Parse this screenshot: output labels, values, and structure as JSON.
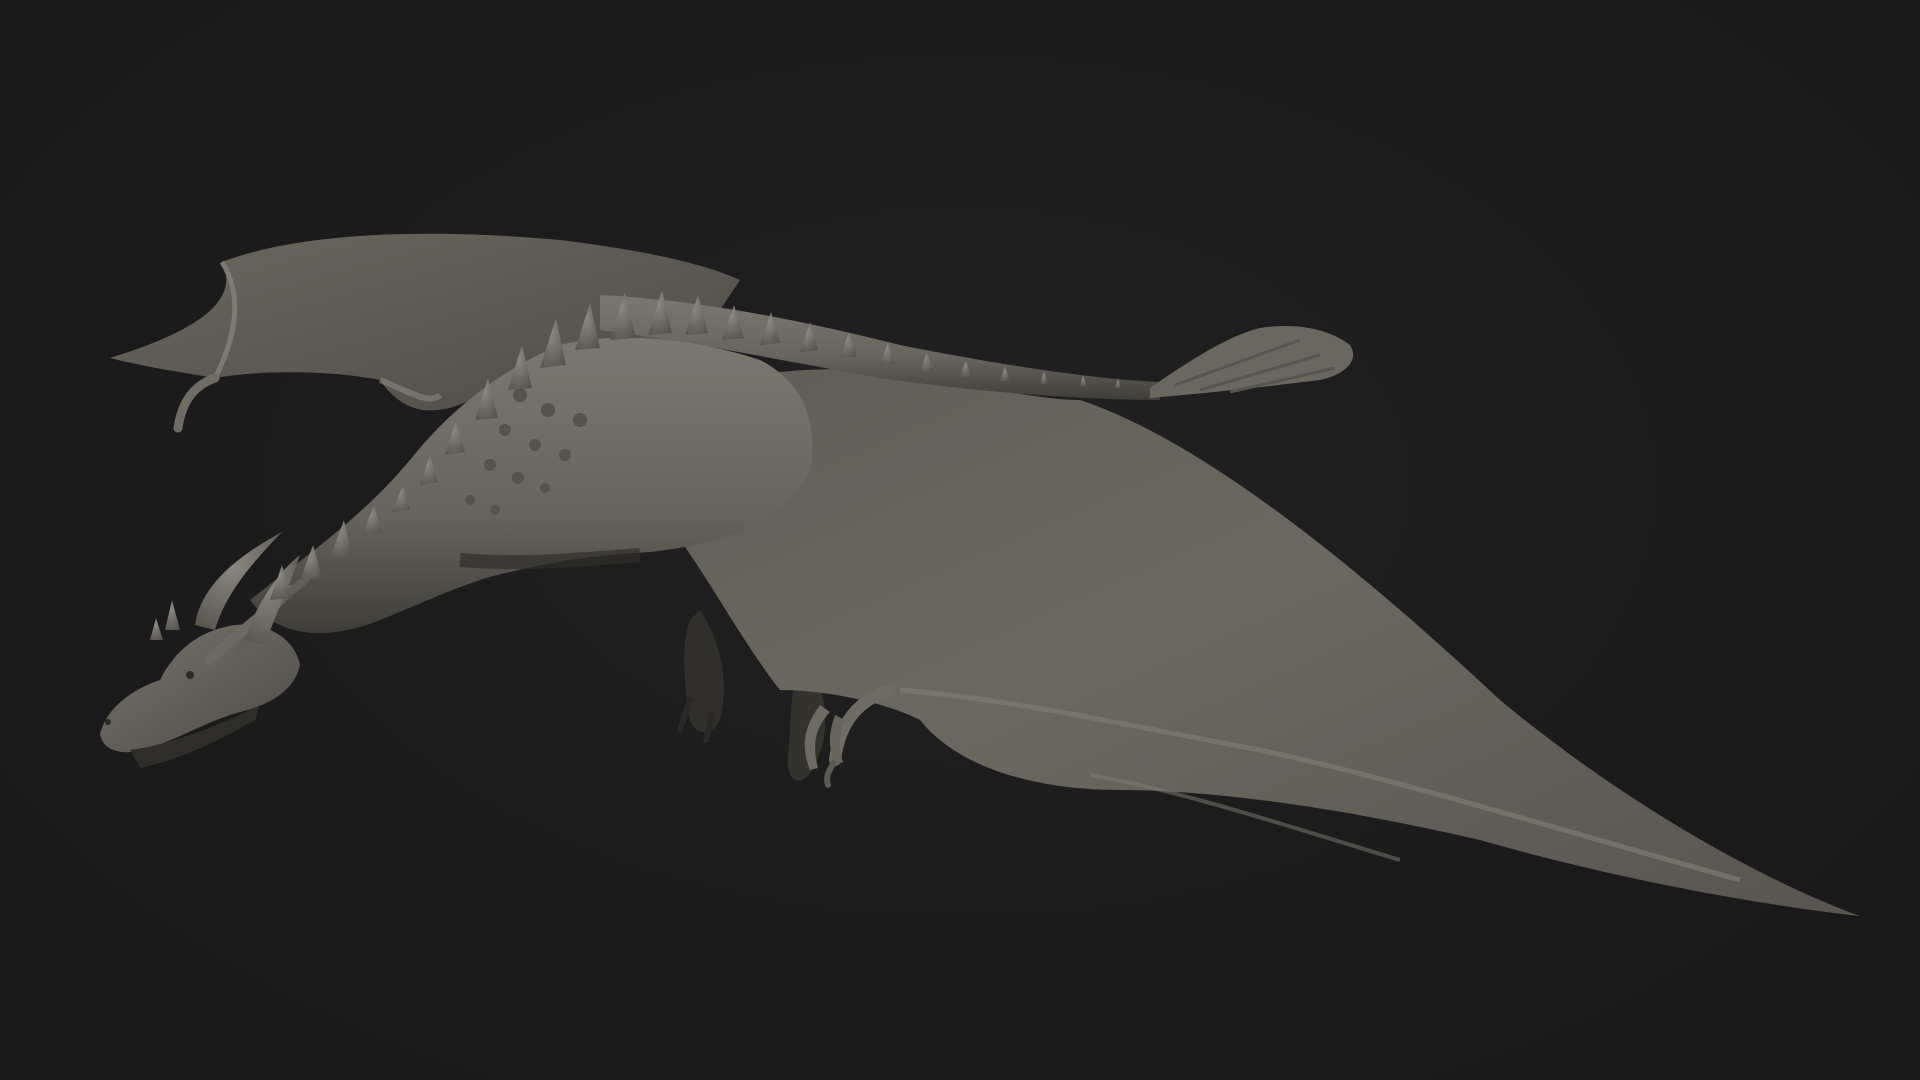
{
  "scene": {
    "subject_icon": "dragon-sculpt",
    "colors": {
      "background": "#1b1b1b",
      "clay_light": "#77756c",
      "clay_mid": "#5e5c54",
      "clay_dark": "#3f3d37",
      "spike": "#8a887f",
      "shadow": "#111111"
    }
  }
}
